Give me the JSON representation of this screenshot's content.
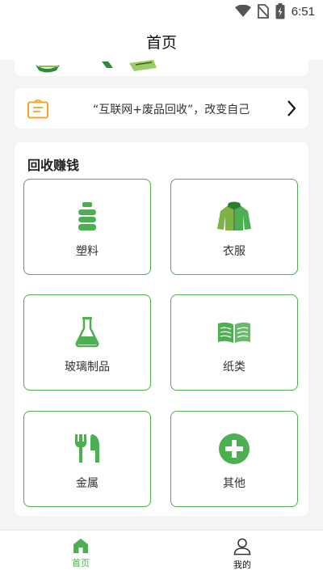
{
  "status_bar": {
    "time": "6:51"
  },
  "app_bar": {
    "title": "首页"
  },
  "notice": {
    "text": "“互联网+废品回收”，改变自己"
  },
  "recycle": {
    "title": "回收赚钱",
    "items": [
      {
        "label": "塑料",
        "icon": "plastic-bottle-icon"
      },
      {
        "label": "衣服",
        "icon": "jacket-icon"
      },
      {
        "label": "玻璃制品",
        "icon": "flask-icon"
      },
      {
        "label": "纸类",
        "icon": "paper-icon"
      },
      {
        "label": "金属",
        "icon": "cutlery-icon"
      },
      {
        "label": "其他",
        "icon": "plus-circle-icon"
      }
    ]
  },
  "bottom_nav": {
    "items": [
      {
        "label": "首页",
        "icon": "home-icon",
        "active": true
      },
      {
        "label": "我的",
        "icon": "person-icon",
        "active": false
      }
    ]
  },
  "colors": {
    "accent": "#4caf50",
    "notice_icon": "#f5a623",
    "background": "#f4f4f4"
  }
}
